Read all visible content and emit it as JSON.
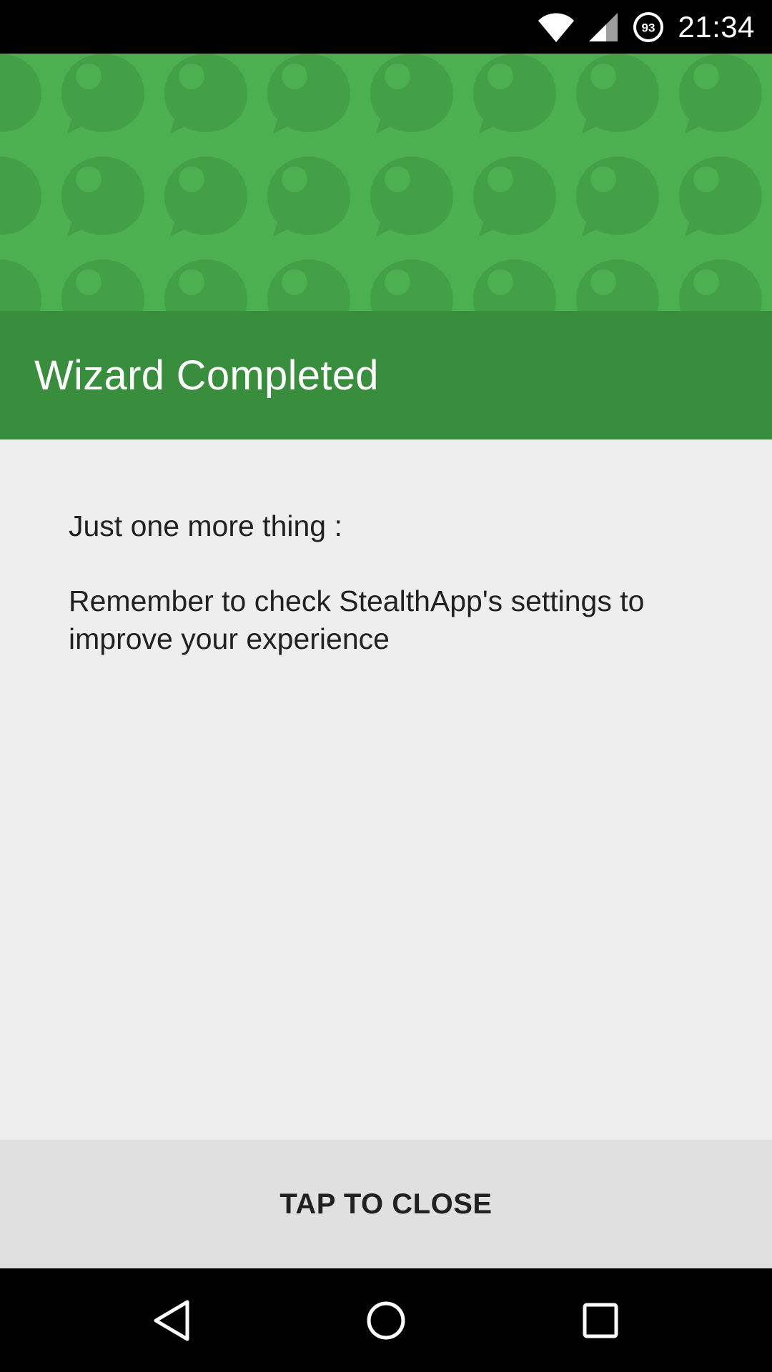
{
  "status_bar": {
    "time": "21:34",
    "data_saver_badge": "93",
    "icons": [
      "wifi-icon",
      "cell-signal-icon",
      "data-saver-icon"
    ]
  },
  "colors": {
    "hero_green": "#4caf50",
    "title_green": "#388e3c",
    "background": "#eeeeee",
    "button_bg": "#e0e0e0",
    "text": "#212121"
  },
  "title": "Wizard Completed",
  "content": {
    "line1": "Just one more thing :",
    "line2": "Remember to check StealthApp's settings to improve your experience"
  },
  "action": {
    "close_label": "TAP TO CLOSE"
  },
  "nav": {
    "icons": [
      "back-icon",
      "home-icon",
      "recents-icon"
    ]
  }
}
